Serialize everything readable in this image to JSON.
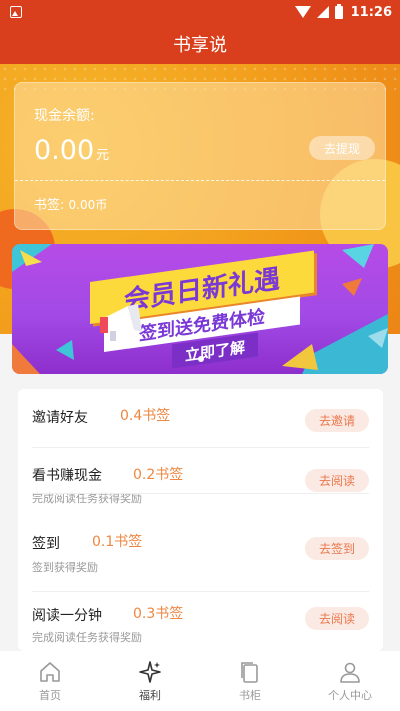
{
  "status_bar": {
    "time": "11:26"
  },
  "app_title": "书享说",
  "balance_card": {
    "label": "现金余额:",
    "amount": "0.00",
    "amount_unit": "元",
    "withdraw_label": "去提现",
    "bookmark_label": "书签:",
    "bookmark_value": "0.00币"
  },
  "banner": {
    "line1": "会员日新礼遇",
    "line2": "签到送免费体检",
    "button": "立即了解"
  },
  "tasks": [
    {
      "title": "邀请好友",
      "reward": "0.4书签",
      "subtitle": "",
      "button": "去邀请"
    },
    {
      "title": "看书赚现金",
      "reward": "0.2书签",
      "subtitle": "完成阅读任务获得奖励",
      "button": "去阅读"
    },
    {
      "title": "签到",
      "reward": "0.1书签",
      "subtitle": "签到获得奖励",
      "button": "去签到"
    },
    {
      "title": "阅读一分钟",
      "reward": "0.3书签",
      "subtitle": "完成阅读任务获得奖励",
      "button": "去阅读"
    }
  ],
  "tabbar": [
    {
      "label": "首页",
      "icon": "home-icon"
    },
    {
      "label": "福利",
      "icon": "sparkle-icon",
      "active": true
    },
    {
      "label": "书柜",
      "icon": "bookshelf-icon"
    },
    {
      "label": "个人中心",
      "icon": "person-icon"
    }
  ],
  "colors": {
    "header": "#d93f1c",
    "accent": "#ee8742",
    "tab_active": "#444444"
  }
}
